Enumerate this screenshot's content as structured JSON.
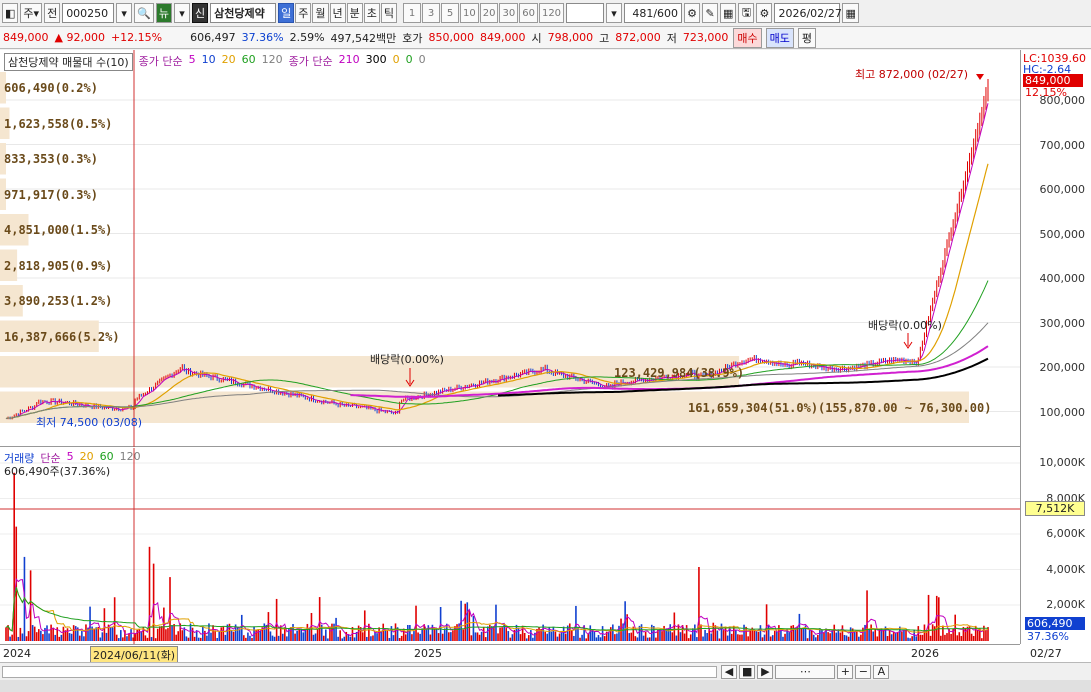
{
  "toolbar": {
    "period_label": "주",
    "jeon_label": "전",
    "code": "000250",
    "news_label": "뉴",
    "sin_label": "신",
    "stock_name": "삼천당제약",
    "period_tabs": [
      "일",
      "주",
      "월",
      "년",
      "분",
      "초",
      "틱"
    ],
    "minute_options": [
      "1",
      "3",
      "5",
      "10",
      "20",
      "30",
      "60",
      "120"
    ],
    "count": "481",
    "count_total": "/600",
    "date": "2026/02/27"
  },
  "quote": {
    "price": "849,000",
    "change": "▲ 92,000",
    "change_pct": "+12.15%",
    "volume": "606,497",
    "vol_ratio": "37.36%",
    "turnover": "2.59%",
    "amount": "497,542백만",
    "ask_label": "호가",
    "ask1": "850,000",
    "ask2": "849,000",
    "open_label": "시",
    "open": "798,000",
    "high_label": "고",
    "high": "872,000",
    "low_label": "저",
    "low": "723,000",
    "buy_label": "매수",
    "sell_label": "매도",
    "eval_label": "평"
  },
  "price_legend": {
    "title": "삼천당제약 매물대 수(10)",
    "ma_label": "종가 단순",
    "ma_periods": [
      "5",
      "10",
      "20",
      "60",
      "120"
    ],
    "ma2_label": "종가 단순",
    "ma2_periods": [
      "210",
      "300",
      "0",
      "0",
      "0"
    ]
  },
  "volume_profile": [
    {
      "label": "606,490(0.2%)",
      "fraction": 0.002
    },
    {
      "label": "1,623,558(0.5%)",
      "fraction": 0.005
    },
    {
      "label": "833,353(0.3%)",
      "fraction": 0.003
    },
    {
      "label": "971,917(0.3%)",
      "fraction": 0.003
    },
    {
      "label": "4,851,000(1.5%)",
      "fraction": 0.015
    },
    {
      "label": "2,818,905(0.9%)",
      "fraction": 0.009
    },
    {
      "label": "3,890,253(1.2%)",
      "fraction": 0.012
    },
    {
      "label": "16,387,666(5.2%)",
      "fraction": 0.052
    },
    {
      "label": "123,429,984(38.9%)",
      "fraction": 0.389
    },
    {
      "label": "161,659,304(51.0%)(155,870.00 ~ 76,300.00)",
      "fraction": 0.51
    }
  ],
  "annotations": {
    "high": "최고 872,000 (02/27)",
    "low": "최저 74,500 (03/08)",
    "dividend1": "배당락(0.00%)",
    "dividend2": "배당락(0.00%)"
  },
  "price_axis": {
    "lc": "LC:1039.60",
    "hc": "HC:-2.64",
    "current": "849,000",
    "current_pct": "12.15%",
    "ticks": [
      "800,000",
      "700,000",
      "600,000",
      "500,000",
      "400,000",
      "300,000",
      "200,000",
      "100,000"
    ]
  },
  "volume_legend": {
    "label": "거래량",
    "ma_label": "단순",
    "ma_periods": [
      "5",
      "20",
      "60",
      "120"
    ],
    "current": "606,490주(37.36%)"
  },
  "volume_axis": {
    "ticks": [
      "10,000K",
      "8,000K",
      "6,000K",
      "4,000K",
      "2,000K"
    ],
    "marker": "7,512K",
    "current": "606,490",
    "current_pct": "37.36%"
  },
  "date_axis": {
    "labels": [
      "2024",
      "2024/06/11(화)",
      "2025",
      "2026",
      "02/27"
    ]
  },
  "colors": {
    "up": "#e00000",
    "down": "#1040d0",
    "profile": "#f5e6d0",
    "crosshair": "#d03030"
  }
}
